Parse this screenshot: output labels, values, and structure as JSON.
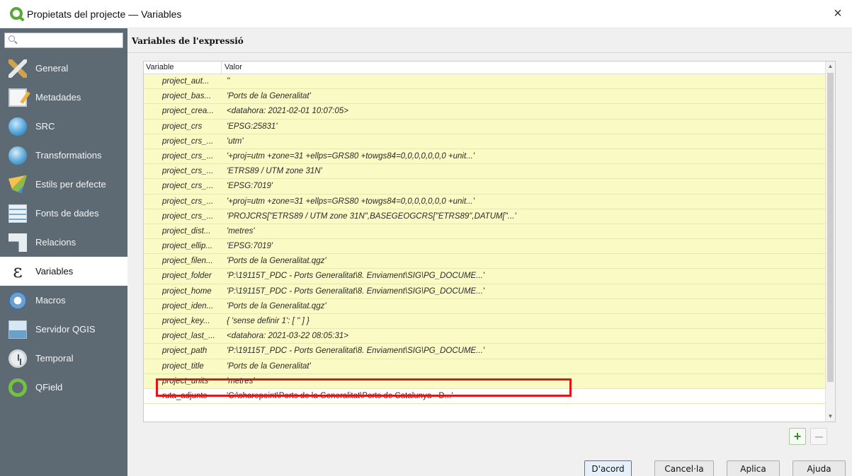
{
  "window": {
    "title": "Propietats del projecte — Variables",
    "close_symbol": "×"
  },
  "sidebar": {
    "search_placeholder": "",
    "items": [
      {
        "label": "General",
        "icon": "general-icon"
      },
      {
        "label": "Metadades",
        "icon": "metadata-icon"
      },
      {
        "label": "SRC",
        "icon": "crs-globe-icon"
      },
      {
        "label": "Transformations",
        "icon": "transformations-icon"
      },
      {
        "label": "Estils per defecte",
        "icon": "styles-icon"
      },
      {
        "label": "Fonts de dades",
        "icon": "data-sources-icon"
      },
      {
        "label": "Relacions",
        "icon": "relations-icon"
      },
      {
        "label": "Variables",
        "icon": "epsilon-icon",
        "active": true
      },
      {
        "label": "Macros",
        "icon": "macros-icon"
      },
      {
        "label": "Servidor QGIS",
        "icon": "qgis-server-icon"
      },
      {
        "label": "Temporal",
        "icon": "clock-icon"
      },
      {
        "label": "QField",
        "icon": "qfield-icon"
      }
    ]
  },
  "main": {
    "section_title": "Variables de l'expressió",
    "table": {
      "columns": [
        "Variable",
        "Valor"
      ],
      "rows": [
        {
          "name": "project_aut...",
          "value": "''"
        },
        {
          "name": "project_bas...",
          "value": "'Ports de la Generalitat'"
        },
        {
          "name": "project_crea...",
          "value": "<datahora: 2021-02-01 10:07:05>"
        },
        {
          "name": "project_crs",
          "value": "'EPSG:25831'"
        },
        {
          "name": "project_crs_...",
          "value": "'utm'"
        },
        {
          "name": "project_crs_...",
          "value": "'+proj=utm +zone=31 +ellps=GRS80 +towgs84=0,0,0,0,0,0,0 +unit...'"
        },
        {
          "name": "project_crs_...",
          "value": "'ETRS89 / UTM zone 31N'"
        },
        {
          "name": "project_crs_...",
          "value": "'EPSG:7019'"
        },
        {
          "name": "project_crs_...",
          "value": "'+proj=utm +zone=31 +ellps=GRS80 +towgs84=0,0,0,0,0,0,0 +unit...'"
        },
        {
          "name": "project_crs_...",
          "value": "'PROJCRS[\"ETRS89 / UTM zone 31N\",BASEGEOGCRS[\"ETRS89\",DATUM[\"...'"
        },
        {
          "name": "project_dist...",
          "value": "'metres'"
        },
        {
          "name": "project_ellip...",
          "value": "'EPSG:7019'"
        },
        {
          "name": "project_filen...",
          "value": "'Ports de la Generalitat.qgz'"
        },
        {
          "name": "project_folder",
          "value": "'P:\\19115T_PDC - Ports Generalitat\\8. Enviament\\SIG\\PG_DOCUME...'"
        },
        {
          "name": "project_home",
          "value": "'P:\\19115T_PDC - Ports Generalitat\\8. Enviament\\SIG\\PG_DOCUME...'"
        },
        {
          "name": "project_iden...",
          "value": "'Ports de la Generalitat.qgz'"
        },
        {
          "name": "project_key...",
          "value": "{ 'sense definir 1': [ '' ] }"
        },
        {
          "name": "project_last_...",
          "value": "<datahora: 2021-03-22 08:05:31>"
        },
        {
          "name": "project_path",
          "value": "'P:\\19115T_PDC - Ports Generalitat\\8. Enviament\\SIG\\PG_DOCUME...'"
        },
        {
          "name": "project_title",
          "value": "'Ports de la Generalitat'"
        },
        {
          "name": "project_units",
          "value": "'metres'"
        },
        {
          "name": "ruta_adjunts",
          "value": "'C:\\sharepoint\\Ports de la Generalitat\\Ports de Catalunya - D...'",
          "editable": true,
          "highlighted": true
        }
      ]
    },
    "buttons": {
      "ok": "D'acord",
      "cancel": "Cancel·la",
      "apply": "Aplica",
      "help": "Ajuda"
    }
  },
  "colors": {
    "sidebar_bg": "#5e6a73",
    "readonly_row_bg": "#fafac4",
    "highlight_border": "#e0161b",
    "primary_button_border": "#2f7bd6"
  }
}
